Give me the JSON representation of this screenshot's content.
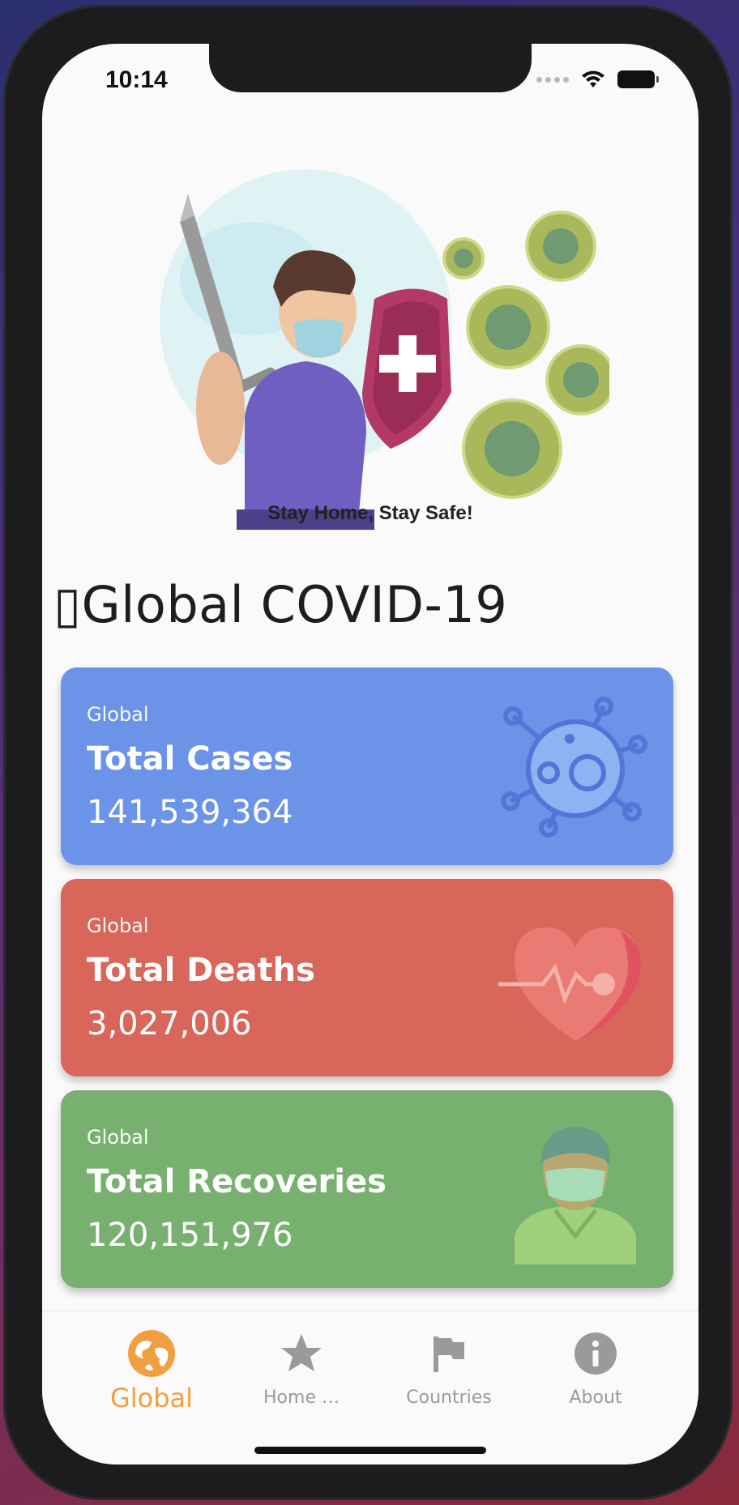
{
  "status_bar": {
    "time": "10:14"
  },
  "hero": {
    "tagline": "Stay Home, Stay Safe!"
  },
  "page": {
    "title": "Global COVID-19",
    "title_prefix_glyph": "▯"
  },
  "cards": [
    {
      "kicker": "Global",
      "title": "Total Cases",
      "value": "141,539,364",
      "color": "#6b93e8",
      "icon": "virus-icon"
    },
    {
      "kicker": "Global",
      "title": "Total Deaths",
      "value": "3,027,006",
      "color": "#d9665a",
      "icon": "heartbeat-icon"
    },
    {
      "kicker": "Global",
      "title": "Total Recoveries",
      "value": "120,151,976",
      "color": "#78b06f",
      "icon": "masked-person-icon"
    }
  ],
  "tabbar": {
    "tabs": [
      {
        "label": "Global",
        "icon": "globe-icon",
        "active": true
      },
      {
        "label": "Home …",
        "icon": "star-icon",
        "active": false
      },
      {
        "label": "Countries",
        "icon": "flag-icon",
        "active": false
      },
      {
        "label": "About",
        "icon": "info-icon",
        "active": false
      }
    ],
    "active_color": "#f0a040",
    "inactive_color": "#9a9a9a"
  }
}
